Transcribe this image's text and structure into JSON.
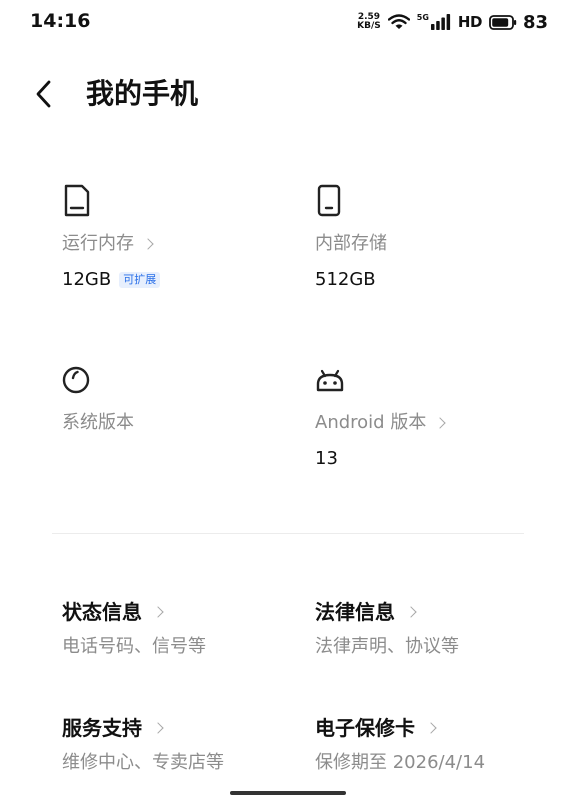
{
  "status_bar": {
    "time": "14:16",
    "net_speed_value": "2.59",
    "net_speed_unit": "KB/S",
    "signal_label": "5G",
    "hd_label": "HD",
    "battery_level": "83"
  },
  "header": {
    "title": "我的手机"
  },
  "info": {
    "ram": {
      "label": "运行内存",
      "value": "12GB",
      "badge": "可扩展"
    },
    "storage": {
      "label": "内部存储",
      "value": "512GB"
    },
    "system_version": {
      "label": "系统版本"
    },
    "android_version": {
      "label": "Android 版本",
      "value": "13"
    }
  },
  "links": {
    "status_info": {
      "title": "状态信息",
      "subtitle": "电话号码、信号等"
    },
    "legal_info": {
      "title": "法律信息",
      "subtitle": "法律声明、协议等"
    },
    "service_support": {
      "title": "服务支持",
      "subtitle": "维修中心、专卖店等"
    },
    "warranty_card": {
      "title": "电子保修卡",
      "subtitle": "保修期至 2026/4/14"
    }
  },
  "icons": {
    "ram": "sd-card-icon",
    "storage": "phone-icon",
    "system": "os-logo-icon",
    "android": "android-icon",
    "back": "back-arrow-icon"
  }
}
